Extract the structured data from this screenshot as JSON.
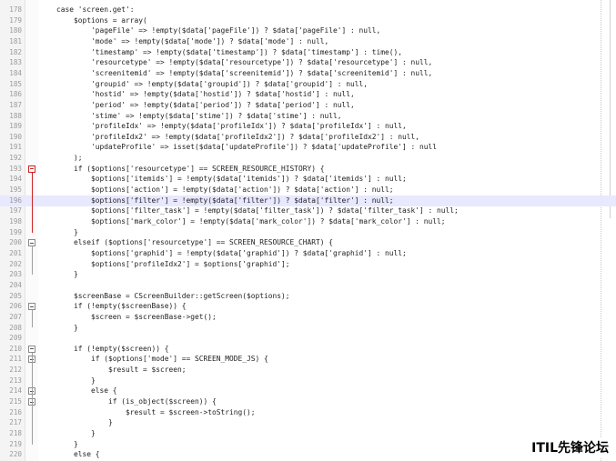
{
  "editor": {
    "highlight_line": 196,
    "lines": [
      {
        "num": "178",
        "text": "    case 'screen.get':"
      },
      {
        "num": "179",
        "text": "        $options = array("
      },
      {
        "num": "180",
        "text": "            'pageFile' => !empty($data['pageFile']) ? $data['pageFile'] : null,"
      },
      {
        "num": "181",
        "text": "            'mode' => !empty($data['mode']) ? $data['mode'] : null,"
      },
      {
        "num": "182",
        "text": "            'timestamp' => !empty($data['timestamp']) ? $data['timestamp'] : time(),"
      },
      {
        "num": "183",
        "text": "            'resourcetype' => !empty($data['resourcetype']) ? $data['resourcetype'] : null,"
      },
      {
        "num": "184",
        "text": "            'screenitemid' => !empty($data['screenitemid']) ? $data['screenitemid'] : null,"
      },
      {
        "num": "185",
        "text": "            'groupid' => !empty($data['groupid']) ? $data['groupid'] : null,"
      },
      {
        "num": "186",
        "text": "            'hostid' => !empty($data['hostid']) ? $data['hostid'] : null,"
      },
      {
        "num": "187",
        "text": "            'period' => !empty($data['period']) ? $data['period'] : null,"
      },
      {
        "num": "188",
        "text": "            'stime' => !empty($data['stime']) ? $data['stime'] : null,"
      },
      {
        "num": "189",
        "text": "            'profileIdx' => !empty($data['profileIdx']) ? $data['profileIdx'] : null,"
      },
      {
        "num": "190",
        "text": "            'profileIdx2' => !empty($data['profileIdx2']) ? $data['profileIdx2'] : null,"
      },
      {
        "num": "191",
        "text": "            'updateProfile' => isset($data['updateProfile']) ? $data['updateProfile'] : null"
      },
      {
        "num": "192",
        "text": "        );"
      },
      {
        "num": "193",
        "text": "        if ($options['resourcetype'] == SCREEN_RESOURCE_HISTORY) {"
      },
      {
        "num": "194",
        "text": "            $options['itemids'] = !empty($data['itemids']) ? $data['itemids'] : null;"
      },
      {
        "num": "195",
        "text": "            $options['action'] = !empty($data['action']) ? $data['action'] : null;"
      },
      {
        "num": "196",
        "text": "            $options['filter'] = !empty($data['filter']) ? $data['filter'] : null;"
      },
      {
        "num": "197",
        "text": "            $options['filter_task'] = !empty($data['filter_task']) ? $data['filter_task'] : null;"
      },
      {
        "num": "198",
        "text": "            $options['mark_color'] = !empty($data['mark_color']) ? $data['mark_color'] : null;"
      },
      {
        "num": "199",
        "text": "        }"
      },
      {
        "num": "200",
        "text": "        elseif ($options['resourcetype'] == SCREEN_RESOURCE_CHART) {"
      },
      {
        "num": "201",
        "text": "            $options['graphid'] = !empty($data['graphid']) ? $data['graphid'] : null;"
      },
      {
        "num": "202",
        "text": "            $options['profileIdx2'] = $options['graphid'];"
      },
      {
        "num": "203",
        "text": "        }"
      },
      {
        "num": "204",
        "text": ""
      },
      {
        "num": "205",
        "text": "        $screenBase = CScreenBuilder::getScreen($options);"
      },
      {
        "num": "206",
        "text": "        if (!empty($screenBase)) {"
      },
      {
        "num": "207",
        "text": "            $screen = $screenBase->get();"
      },
      {
        "num": "208",
        "text": "        }"
      },
      {
        "num": "209",
        "text": ""
      },
      {
        "num": "210",
        "text": "        if (!empty($screen)) {"
      },
      {
        "num": "211",
        "text": "            if ($options['mode'] == SCREEN_MODE_JS) {"
      },
      {
        "num": "212",
        "text": "                $result = $screen;"
      },
      {
        "num": "213",
        "text": "            }"
      },
      {
        "num": "214",
        "text": "            else {"
      },
      {
        "num": "215",
        "text": "                if (is_object($screen)) {"
      },
      {
        "num": "216",
        "text": "                    $result = $screen->toString();"
      },
      {
        "num": "217",
        "text": "                }"
      },
      {
        "num": "218",
        "text": "            }"
      },
      {
        "num": "219",
        "text": "        }"
      },
      {
        "num": "220",
        "text": "        else {"
      }
    ]
  },
  "watermark": {
    "text": "ITIL先锋论坛"
  }
}
